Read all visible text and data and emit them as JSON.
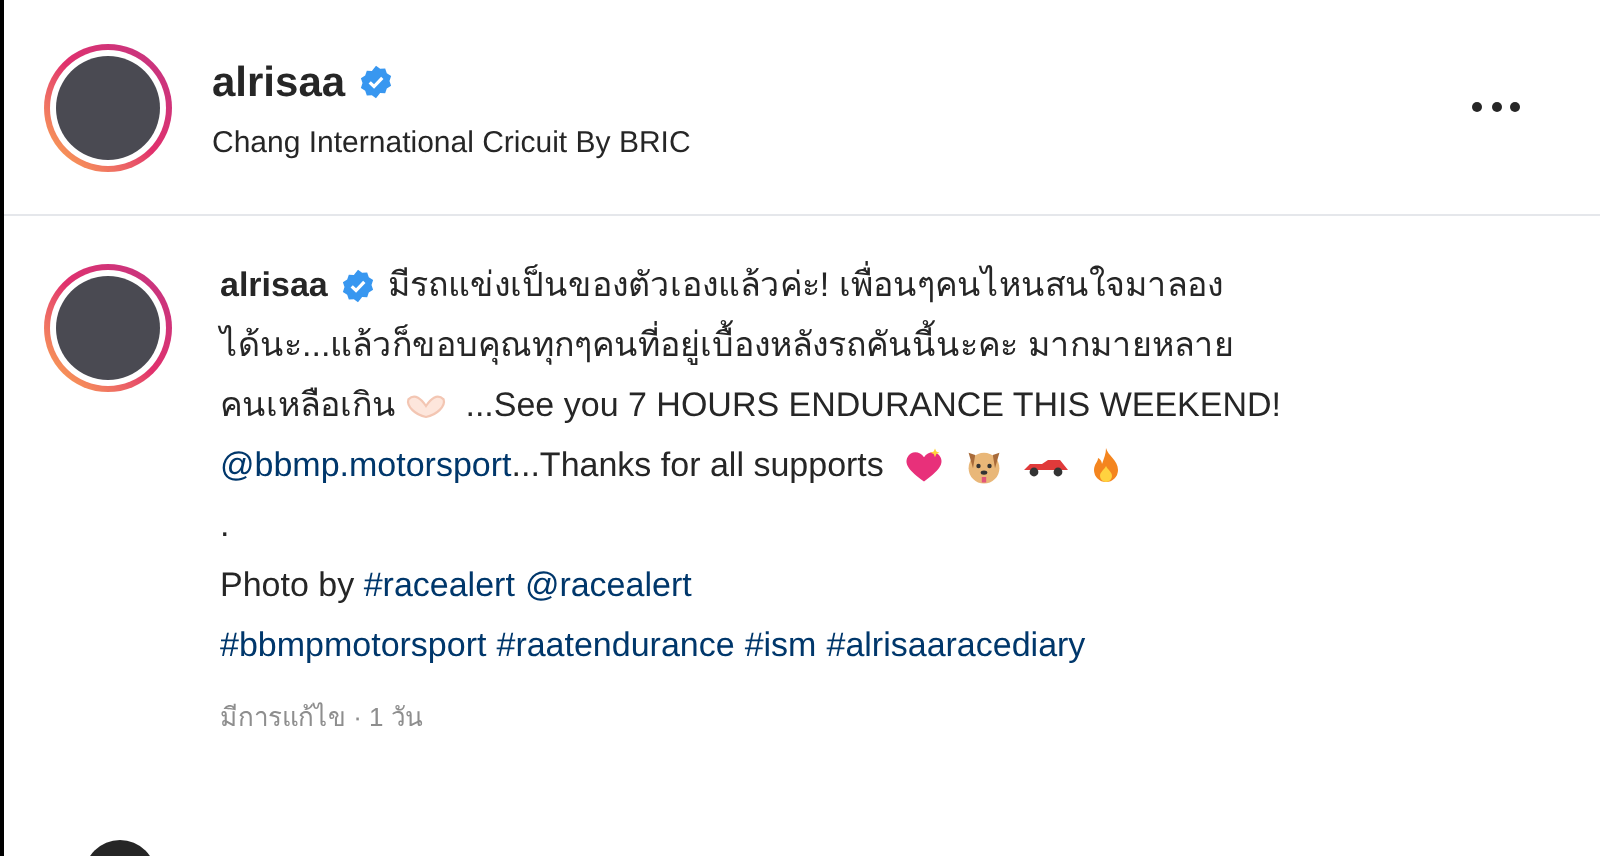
{
  "header": {
    "username": "alrisaa",
    "verified": true,
    "location": "Chang International Cricuit By BRIC"
  },
  "caption": {
    "username": "alrisaa",
    "verified": true,
    "lines": [
      [
        {
          "kind": "text",
          "text": "มีรถแข่งเป็นของตัวเองแล้วค่ะ! เพื่อนๆคนไหนสนใจมาลอง"
        }
      ],
      [
        {
          "kind": "text",
          "text": "ได้นะ...แล้วก็ขอบคุณทุกๆคนที่อยู่เบื้องหลังรถคันนี้นะคะ มากมายหลาย"
        }
      ],
      [
        {
          "kind": "text",
          "text": "คนเหลือเกิน"
        },
        {
          "kind": "hands"
        },
        {
          "kind": "text",
          "text": " ...See you 7 HOURS ENDURANCE THIS WEEKEND!"
        }
      ],
      [
        {
          "kind": "link",
          "text": "@bbmp.motorsport"
        },
        {
          "kind": "text",
          "text": "...Thanks for all supports "
        },
        {
          "kind": "heart"
        },
        {
          "kind": "dog"
        },
        {
          "kind": "car"
        },
        {
          "kind": "fire"
        }
      ],
      [
        {
          "kind": "text",
          "text": "."
        }
      ],
      [
        {
          "kind": "text",
          "text": "Photo by "
        },
        {
          "kind": "link",
          "text": "#racealert"
        },
        {
          "kind": "link",
          "text": "@racealert"
        }
      ],
      [
        {
          "kind": "link",
          "text": "#bbmpmotorsport"
        },
        {
          "kind": "link",
          "text": "#raatendurance"
        },
        {
          "kind": "link",
          "text": "#ism"
        },
        {
          "kind": "link",
          "text": "#alrisaaracediary"
        }
      ]
    ],
    "meta": "มีการแก้ไข · 1 วัน"
  }
}
